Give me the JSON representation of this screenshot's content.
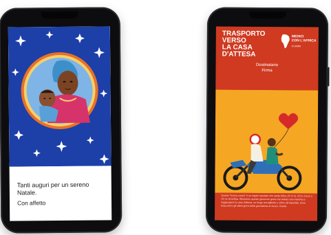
{
  "left_card": {
    "greeting": "Tanti auguri per un sereno Natale.",
    "closing": "Con affetto"
  },
  "right_card": {
    "title_lines": [
      "TRASPORTO",
      "VERSO",
      "LA CASA D'ATTESA"
    ],
    "logo_lines": [
      "MEDICI",
      "CON L'AFRICA",
      "CUAMM"
    ],
    "recipient_label": "Destinatario",
    "sign_label": "Firma",
    "body_text": "Questo \"buona causa\" è un regalo speciale che rende felice chi lo fa, chi lo riceve e chi ne beneficia. Attraverso questo generoso gesto hai aiutato una mamma a raggiungere la casa d'attesa, un luogo accogliente e vicino all'ospedale, dove trascorrere gli ultimi giorni della gravidanza al sicuro. Grazie"
  },
  "colors": {
    "left_background": "#1d3fa8",
    "left_frame": "#e8702a",
    "right_top": "#cf3a21",
    "right_illustration": "#f5a623",
    "heart": "#d62a2a"
  },
  "icons": [
    "star-icon",
    "heart-balloon-icon",
    "africa-logo-icon"
  ]
}
